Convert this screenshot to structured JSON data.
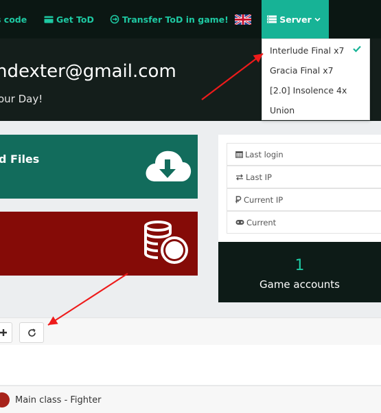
{
  "nav": {
    "code_label": "s code",
    "gettod_label": "Get ToD",
    "transfer_label": "Transfer ToD in game!",
    "server_label": "Server"
  },
  "hero": {
    "email": "ndexter@gmail.com",
    "subtitle": "our Day!"
  },
  "server_dropdown": {
    "items": [
      {
        "label": "Interlude Final x7",
        "selected": true
      },
      {
        "label": "Gracia Final x7",
        "selected": false
      },
      {
        "label": "[2.0] Insolence 4x",
        "selected": false
      },
      {
        "label": "Union",
        "selected": false
      }
    ]
  },
  "cards": {
    "files_title": "d Files"
  },
  "info": {
    "last_login": "Last login",
    "last_ip": "Last IP",
    "current_ip": "Current IP",
    "current": "Current"
  },
  "accounts": {
    "count": "1",
    "label": "Game accounts"
  },
  "list": {
    "row_label": "Main class - Fighter"
  },
  "colors": {
    "accent": "#17b396",
    "files_card": "#126c5c",
    "donate_card": "#850b07",
    "dark_bg": "#0b1713",
    "annotation_arrow": "#ee1b1b"
  },
  "icons": {
    "files": "cloud-download-icon",
    "donate": "coins-icon",
    "add": "plus-icon",
    "refresh": "refresh-icon"
  }
}
